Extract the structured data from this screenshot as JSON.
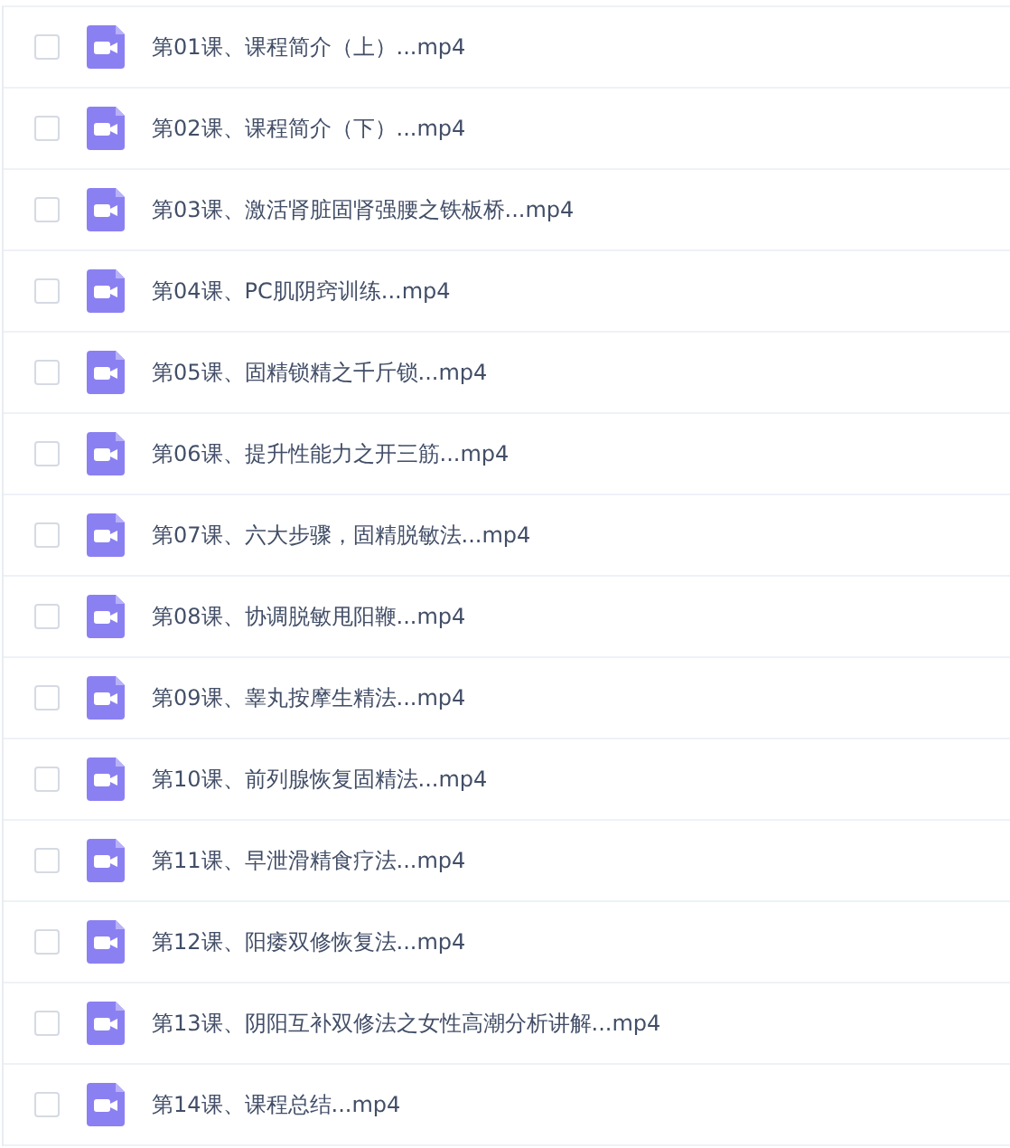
{
  "files": [
    {
      "name": "第01课、课程简介（上）...mp4",
      "checked": false
    },
    {
      "name": "第02课、课程简介（下）...mp4",
      "checked": false
    },
    {
      "name": "第03课、激活肾脏固肾强腰之铁板桥...mp4",
      "checked": false
    },
    {
      "name": "第04课、PC肌阴窍训练...mp4",
      "checked": false
    },
    {
      "name": "第05课、固精锁精之千斤锁...mp4",
      "checked": false
    },
    {
      "name": "第06课、提升性能力之开三筋...mp4",
      "checked": false
    },
    {
      "name": "第07课、六大步骤，固精脱敏法...mp4",
      "checked": false
    },
    {
      "name": "第08课、协调脱敏甩阳鞭...mp4",
      "checked": false
    },
    {
      "name": "第09课、睾丸按摩生精法...mp4",
      "checked": false
    },
    {
      "name": "第10课、前列腺恢复固精法...mp4",
      "checked": false
    },
    {
      "name": "第11课、早泄滑精食疗法...mp4",
      "checked": false
    },
    {
      "name": "第12课、阳痿双修恢复法...mp4",
      "checked": false
    },
    {
      "name": "第13课、阴阳互补双修法之女性高潮分析讲解...mp4",
      "checked": false
    },
    {
      "name": "第14课、课程总结...mp4",
      "checked": false
    }
  ]
}
